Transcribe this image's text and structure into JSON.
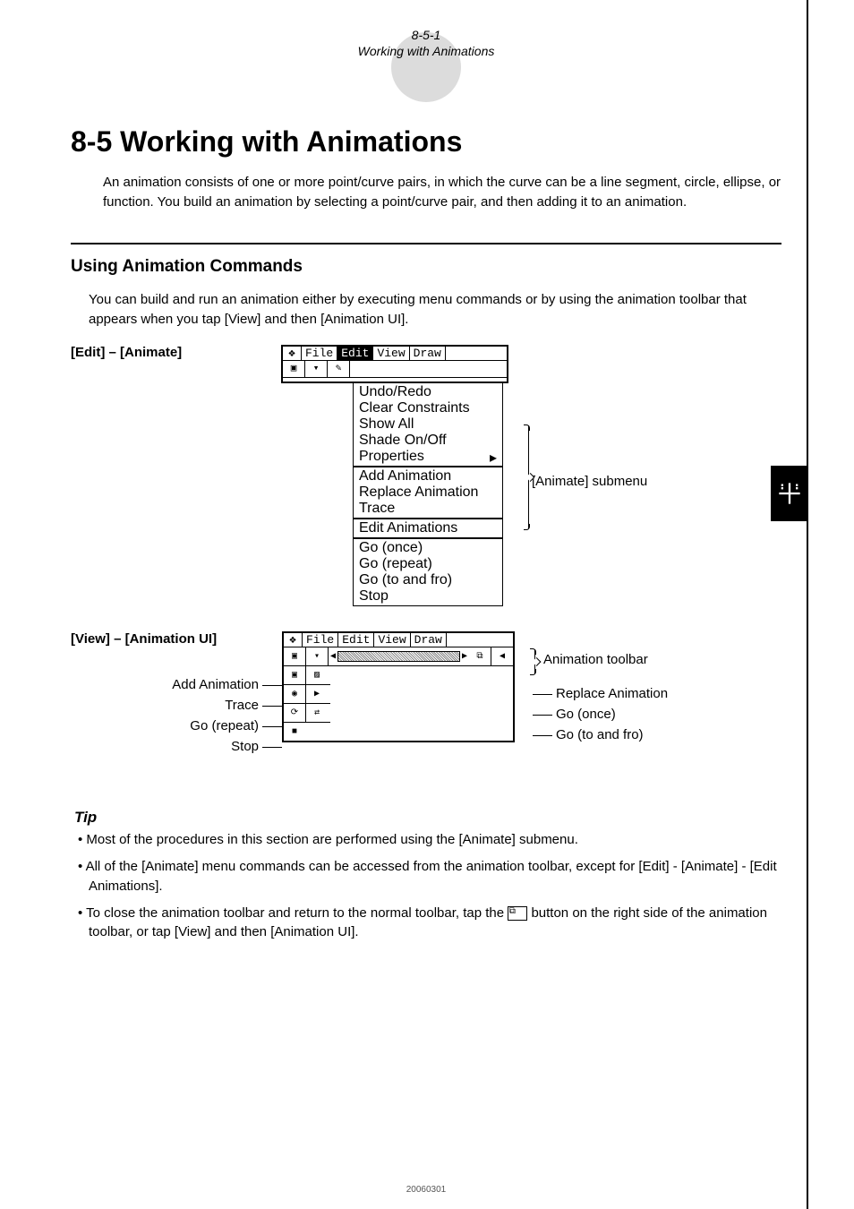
{
  "header": {
    "num": "8-5-1",
    "sub": "Working with Animations"
  },
  "title": "8-5 Working with Animations",
  "intro": "An animation consists of one or more point/curve pairs, in which the curve can be a line segment, circle, ellipse, or function. You build an animation by selecting a point/curve pair, and then adding it to an animation.",
  "section_h": "Using Animation Commands",
  "section_p": "You can build and run an animation either by executing menu commands or by using the animation toolbar that appears when you tap [View] and then [Animation UI].",
  "fig1": {
    "left_label": "[Edit] – [Animate]",
    "menubar": [
      "File",
      "Edit",
      "View",
      "Draw"
    ],
    "highlighted": "Edit",
    "group_top": [
      "Undo/Redo",
      "Clear Constraints",
      "Show All",
      "Shade On/Off",
      "Properties"
    ],
    "group_a": [
      "Add Animation",
      "Replace Animation",
      "Trace"
    ],
    "group_b": [
      "Edit Animations"
    ],
    "group_c": [
      "Go (once)",
      "Go (repeat)",
      "Go (to and fro)",
      "Stop"
    ],
    "callout": "[Animate] submenu"
  },
  "fig2": {
    "left_label": "[View] – [Animation UI]",
    "menubar": [
      "File",
      "Edit",
      "View",
      "Draw"
    ],
    "left_items": [
      "Add Animation",
      "Trace",
      "Go (repeat)",
      "Stop"
    ],
    "right_top": "Animation toolbar",
    "right_items": [
      "Replace Animation",
      "Go (once)",
      "Go (to and fro)"
    ]
  },
  "tip_h": "Tip",
  "tips": [
    "Most of the procedures in this section are performed using the [Animate] submenu.",
    "All of the [Animate] menu commands can be accessed from the animation toolbar, except for [Edit] - [Animate] - [Edit Animations].",
    "To close the animation toolbar and return to the normal toolbar, tap the  button on the right side of the animation toolbar, or tap [View] and then [Animation UI]."
  ],
  "tip3_pre": "To close the animation toolbar and return to the normal toolbar, tap the ",
  "tip3_icon": "⧉",
  "tip3_post": " button on the right side of the animation toolbar, or tap [View] and then [Animation UI].",
  "footer": "20060301"
}
